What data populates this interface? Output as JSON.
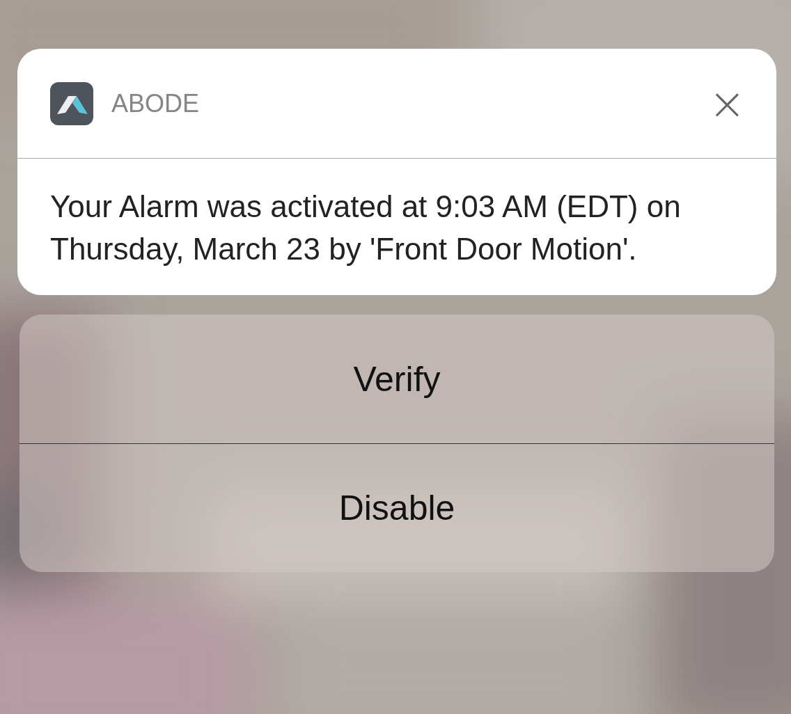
{
  "notification": {
    "app_name": "ABODE",
    "close_glyph": "×",
    "message": "Your Alarm was activated at 9:03 AM (EDT)  on Thursday, March 23 by 'Front Door Motion'."
  },
  "actions": [
    {
      "label": "Verify"
    },
    {
      "label": "Disable"
    }
  ]
}
